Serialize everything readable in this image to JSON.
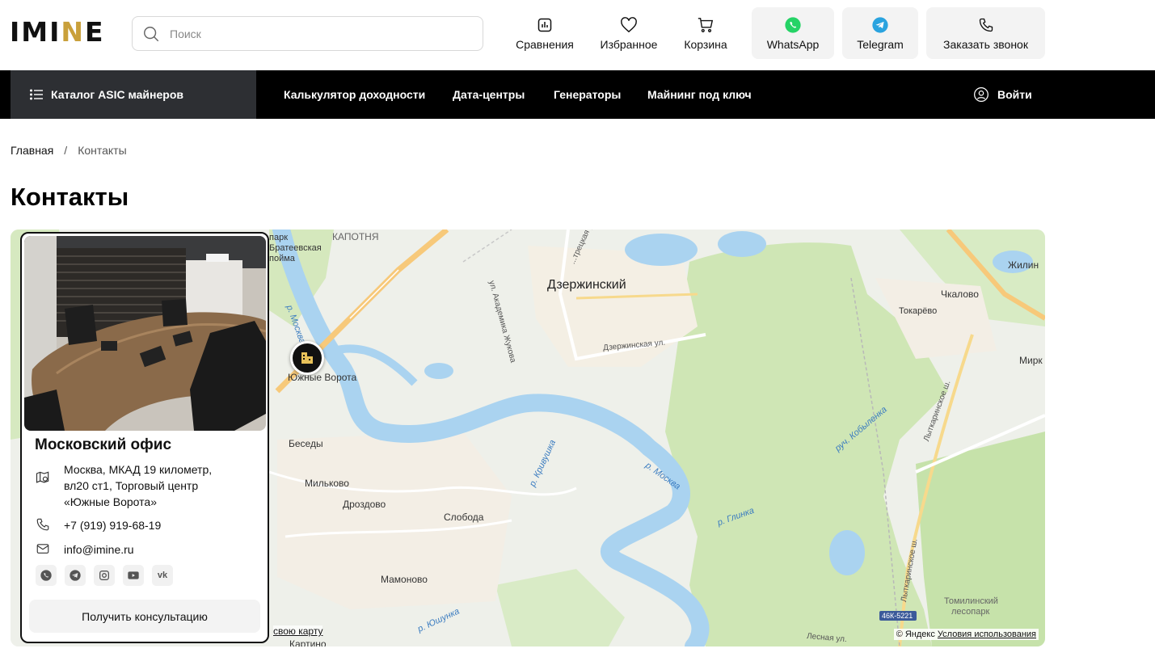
{
  "header": {
    "logo": {
      "part1": "IMI",
      "part2": "N",
      "part3": "E"
    },
    "search": {
      "placeholder": "Поиск",
      "value": ""
    },
    "actions": {
      "compare": "Сравнения",
      "favorites": "Избранное",
      "cart": "Корзина",
      "whatsapp": "WhatsApp",
      "telegram": "Telegram",
      "callback": "Заказать звонок"
    }
  },
  "nav": {
    "catalog": "Каталог ASIC майнеров",
    "links": [
      "Калькулятор доходности",
      "Дата-центры",
      "Генераторы",
      "Майнинг под ключ"
    ],
    "login": "Войти"
  },
  "breadcrumb": {
    "home": "Главная",
    "separator": "/",
    "current": "Контакты"
  },
  "page": {
    "title": "Контакты"
  },
  "office": {
    "title": "Московский офис",
    "address": "Москва, МКАД 19 километр, вл20 ст1, Торговый центр «Южные Ворота»",
    "phone": "+7 (919) 919-68-19",
    "email": "info@imine.ru",
    "socials": [
      "whatsapp-icon",
      "telegram-icon",
      "instagram-icon",
      "youtube-icon",
      "vk-icon"
    ],
    "vk_label": "vk",
    "cta": "Получить консультацию"
  },
  "map": {
    "labels": {
      "kapotnya": "КАПОТНЯ",
      "park": "парк",
      "brateevskaya": "Братеевская",
      "poyma": "пойма",
      "dzerzhinsky": "Дзержинский",
      "akademika": "ул. Академика Жукова",
      "tretskaya": "...трецкая ул.",
      "dzerzhinskaya_ul": "Дзержинская ул.",
      "yuzhnye_vorota": "Южные Ворота",
      "besedy": "Беседы",
      "milkovo": "Мильково",
      "drozdovo": "Дроздово",
      "sloboda": "Слобода",
      "mamonovo": "Мамоново",
      "kartino": "Картино",
      "chkalovo": "Чкалово",
      "tokarevo": "Токарёво",
      "zhilin": "Жилин",
      "mirk": "Мирк",
      "tomilinsky": "Томилинский",
      "lesopark": "лесопарк",
      "river_moskva_1": "р. Москва",
      "river_moskva_2": "р. Москва",
      "river_kryvushka": "р. Кривушка",
      "river_glinka": "р. Глинка",
      "river_yushunka": "р. Юшунка",
      "ruch_kobylenka": "руч. Кобыленка",
      "lytkarinskoe_1": "Лыткаринское ш.",
      "lytkarinskoe_2": "Лыткаринское ш.",
      "road_code": "46К-5221",
      "lesnaya": "Лесная ул."
    },
    "own_map": "свою карту",
    "attribution": {
      "prefix": "© Яндекс",
      "terms": "Условия использования"
    }
  }
}
